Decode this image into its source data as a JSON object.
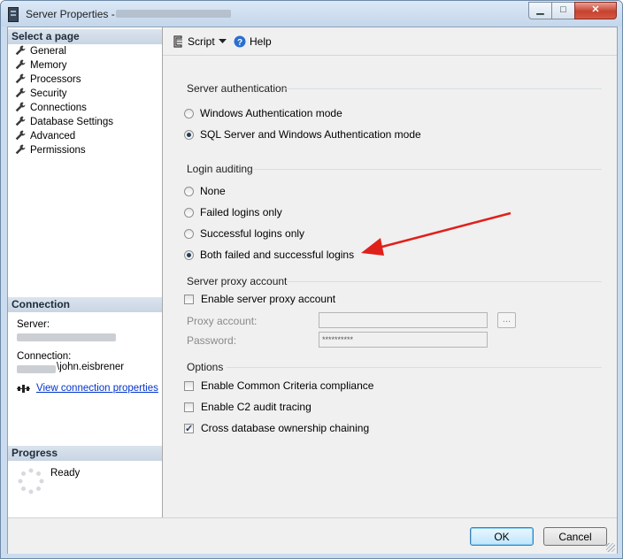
{
  "window": {
    "title": "Server Properties -",
    "controls": {
      "minimize": "▁",
      "maximize": "□",
      "close": "✕"
    }
  },
  "sidebar": {
    "select_page_header": "Select a page",
    "items": [
      {
        "label": "General",
        "icon": "wrench-icon"
      },
      {
        "label": "Memory",
        "icon": "wrench-icon"
      },
      {
        "label": "Processors",
        "icon": "wrench-icon"
      },
      {
        "label": "Security",
        "icon": "wrench-icon",
        "selected": true
      },
      {
        "label": "Connections",
        "icon": "wrench-icon"
      },
      {
        "label": "Database Settings",
        "icon": "wrench-icon"
      },
      {
        "label": "Advanced",
        "icon": "wrench-icon"
      },
      {
        "label": "Permissions",
        "icon": "wrench-icon"
      }
    ],
    "connection": {
      "header": "Connection",
      "server_label": "Server:",
      "connection_label": "Connection:",
      "connection_user_suffix": "\\john.eisbrener",
      "view_link": "View connection properties"
    },
    "progress": {
      "header": "Progress",
      "status": "Ready"
    }
  },
  "toolbar": {
    "script_label": "Script",
    "help_label": "Help"
  },
  "security": {
    "server_auth": {
      "title": "Server authentication",
      "options": [
        {
          "label": "Windows Authentication mode",
          "selected": false
        },
        {
          "label": "SQL Server and Windows Authentication mode",
          "selected": true
        }
      ]
    },
    "login_auditing": {
      "title": "Login auditing",
      "options": [
        {
          "label": "None",
          "selected": false
        },
        {
          "label": "Failed logins only",
          "selected": false
        },
        {
          "label": "Successful logins only",
          "selected": false
        },
        {
          "label": "Both failed and successful logins",
          "selected": true
        }
      ]
    },
    "proxy": {
      "title": "Server proxy account",
      "enable_label": "Enable server proxy account",
      "enabled": false,
      "account_label": "Proxy account:",
      "account_value": "",
      "password_label": "Password:",
      "password_value": "**********",
      "browse_label": "..."
    },
    "options": {
      "title": "Options",
      "items": [
        {
          "label": "Enable Common Criteria compliance",
          "checked": false
        },
        {
          "label": "Enable C2 audit tracing",
          "checked": false
        },
        {
          "label": "Cross database ownership chaining",
          "checked": true
        }
      ]
    }
  },
  "buttons": {
    "ok": "OK",
    "cancel": "Cancel"
  },
  "colors": {
    "annotation_arrow": "#e0201b",
    "accent": "#0033cc"
  }
}
